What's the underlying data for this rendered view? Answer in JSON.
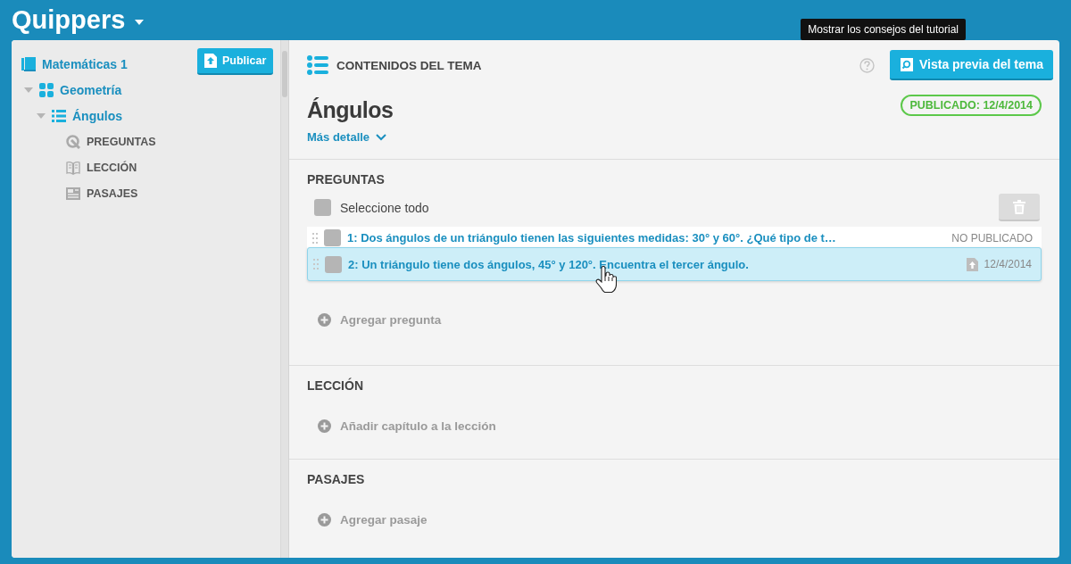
{
  "app": {
    "title": "Quippers"
  },
  "sidebar": {
    "publish_button": "Publicar",
    "tree": [
      {
        "label": "Matemáticas 1",
        "kind": "book",
        "children": [
          {
            "label": "Geometría",
            "kind": "unit",
            "expanded": true,
            "children": [
              {
                "label": "Ángulos",
                "kind": "topic",
                "expanded": true,
                "children": [
                  {
                    "label": "PREGUNTAS",
                    "kind": "questions"
                  },
                  {
                    "label": "LECCIÓN",
                    "kind": "lesson"
                  },
                  {
                    "label": "PASAJES",
                    "kind": "passages"
                  }
                ]
              }
            ]
          }
        ]
      }
    ]
  },
  "header": {
    "title": "CONTENIDOS DEL TEMA",
    "tooltip": "Mostrar los consejos del tutorial",
    "preview_button": "Vista previa del tema"
  },
  "topic": {
    "title": "Ángulos",
    "details_link": "Más detalle",
    "status": "PUBLICADO: 12/4/2014"
  },
  "sections": [
    {
      "title": "PREGUNTAS",
      "select_all": {
        "label": "Seleccione todo",
        "checked": false
      },
      "questions": [
        {
          "text": "1: Dos ángulos de un triángulo tienen las siguientes medidas: 30° y 60°. ¿Qué tipo de t…",
          "status": "NO PUBLICADO",
          "kind": "draft",
          "checked": false,
          "dragging": false
        },
        {
          "text": "2: Un triángulo tiene dos ángulos, 45° y 120°. Encuentra el tercer ángulo.",
          "status": "12/4/2014",
          "kind": "published",
          "checked": false,
          "dragging": true
        }
      ],
      "add": "Agregar pregunta"
    },
    {
      "title": "LECCIÓN",
      "add": "Añadir capítulo a la lección"
    },
    {
      "title": "PASAJES",
      "add": "Agregar pasaje"
    }
  ]
}
